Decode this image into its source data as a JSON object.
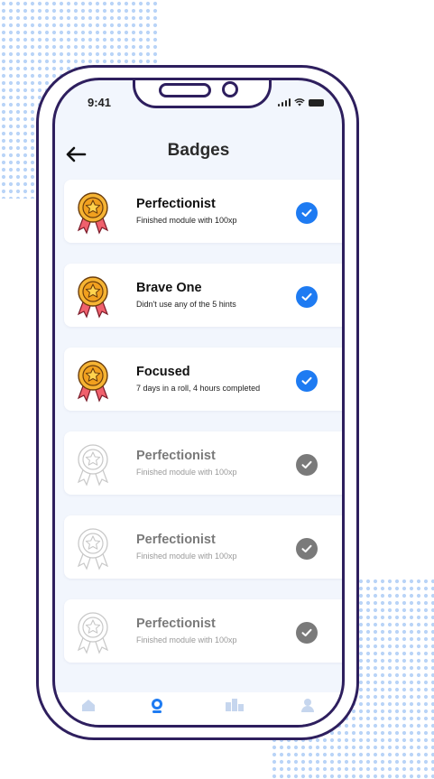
{
  "status_bar": {
    "time": "9:41"
  },
  "header": {
    "title": "Badges"
  },
  "badges": [
    {
      "title": "Perfectionist",
      "description": "Finished module with 100xp",
      "earned": true
    },
    {
      "title": "Brave One",
      "description": "Didn't use any of the 5 hints",
      "earned": true
    },
    {
      "title": "Focused",
      "description": "7 days in a roll, 4 hours completed",
      "earned": true
    },
    {
      "title": "Perfectionist",
      "description": "Finished module with 100xp",
      "earned": false
    },
    {
      "title": "Perfectionist",
      "description": "Finished module with 100xp",
      "earned": false
    },
    {
      "title": "Perfectionist",
      "description": "Finished module with 100xp",
      "earned": false
    }
  ],
  "tab_bar": {
    "items": [
      {
        "icon": "home-icon"
      },
      {
        "icon": "badge-icon",
        "active": true
      },
      {
        "icon": "leaderboard-icon"
      },
      {
        "icon": "profile-icon"
      }
    ]
  },
  "colors": {
    "frame": "#2e1f5e",
    "screen_bg": "#f2f6fd",
    "check_active": "#1e7bf2",
    "check_inactive": "#7a7a7a",
    "dots": "#b9d4f7"
  }
}
